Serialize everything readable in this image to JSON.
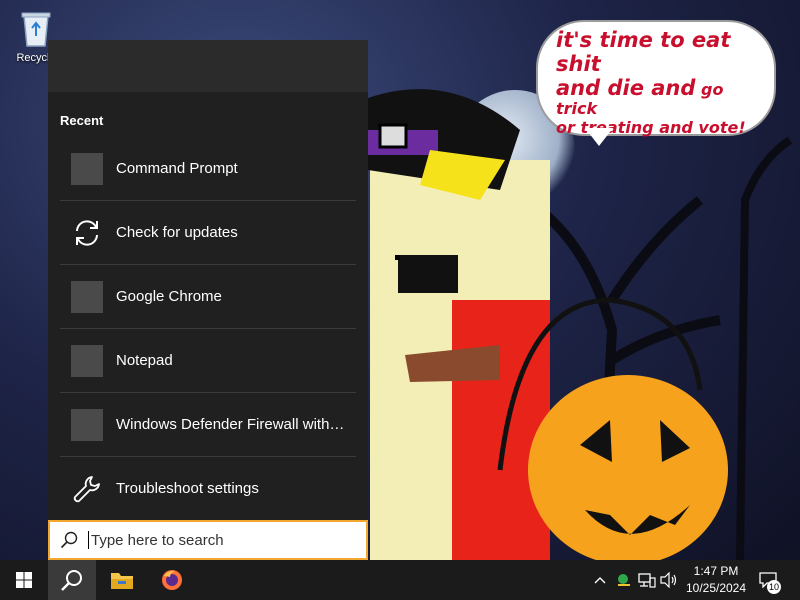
{
  "desktop": {
    "icons": [
      {
        "label": "Recycle",
        "icon": "recycle-bin-icon"
      }
    ],
    "wallpaper": {
      "speech_bubble": {
        "line1": "it's time to eat shit",
        "line2a": "and die and",
        "line2b": "go trick",
        "line3": "or treating and vote!"
      }
    }
  },
  "search_panel": {
    "recent_heading": "Recent",
    "items": [
      {
        "label": "Command Prompt",
        "icon": "app-placeholder-icon"
      },
      {
        "label": "Check for updates",
        "icon": "refresh-icon"
      },
      {
        "label": "Google Chrome",
        "icon": "app-placeholder-icon"
      },
      {
        "label": "Notepad",
        "icon": "app-placeholder-icon"
      },
      {
        "label": "Windows Defender Firewall with ...",
        "icon": "app-placeholder-icon"
      },
      {
        "label": "Troubleshoot settings",
        "icon": "wrench-icon"
      }
    ],
    "search_box": {
      "placeholder": "Type here to search",
      "value": ""
    }
  },
  "taskbar": {
    "buttons": [
      {
        "name": "start",
        "icon": "windows-logo-icon"
      },
      {
        "name": "search",
        "icon": "search-icon",
        "active": true
      },
      {
        "name": "file-explorer",
        "icon": "folder-icon"
      },
      {
        "name": "firefox",
        "icon": "firefox-icon"
      }
    ],
    "tray": {
      "icons": [
        "chevron-up-icon",
        "network-security-icon",
        "network-icon",
        "volume-icon"
      ],
      "time": "1:47 PM",
      "date": "10/25/2024",
      "notification_count": "10"
    }
  },
  "colors": {
    "panel_bg": "#202020",
    "search_border": "#f0a830",
    "taskbar_bg": "#1b1b1b",
    "speech_text": "#c8102e"
  }
}
